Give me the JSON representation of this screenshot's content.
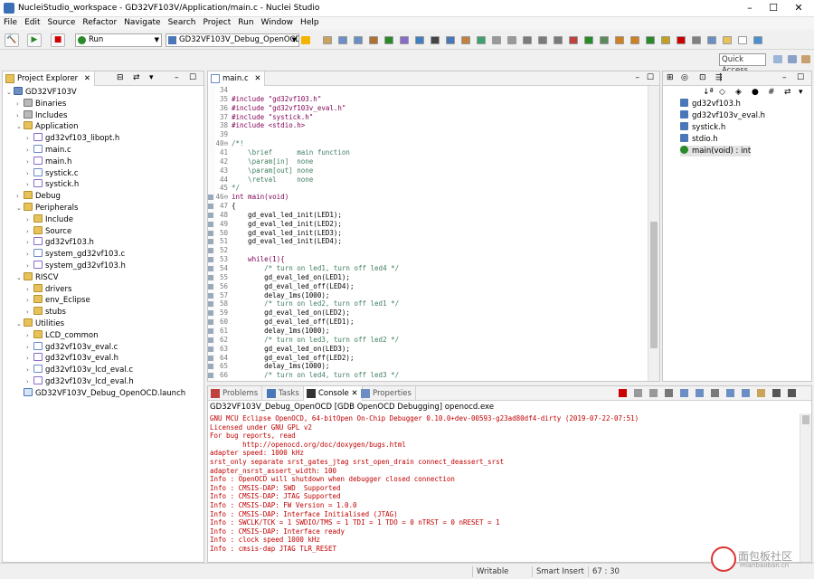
{
  "window": {
    "title": "NucleiStudio_workspace - GD32VF103V/Application/main.c - Nuclei Studio"
  },
  "menu": [
    "File",
    "Edit",
    "Source",
    "Refactor",
    "Navigate",
    "Search",
    "Project",
    "Run",
    "Window",
    "Help"
  ],
  "toolbar": {
    "run_mode": "Run",
    "launch_config": "GD32VF103V_Debug_OpenOCD",
    "quick_access": "Quick Access"
  },
  "project_explorer": {
    "tab_label": "Project Explorer",
    "items": [
      {
        "label": "GD32VF103V",
        "depth": 0,
        "type": "proj",
        "open": true
      },
      {
        "label": "Binaries",
        "depth": 1,
        "type": "bin",
        "open": false
      },
      {
        "label": "Includes",
        "depth": 1,
        "type": "bin",
        "open": false
      },
      {
        "label": "Application",
        "depth": 1,
        "type": "folder",
        "open": true
      },
      {
        "label": "gd32vf103_libopt.h",
        "depth": 2,
        "type": "hfile",
        "open": false
      },
      {
        "label": "main.c",
        "depth": 2,
        "type": "cfile",
        "open": false
      },
      {
        "label": "main.h",
        "depth": 2,
        "type": "hfile",
        "open": false
      },
      {
        "label": "systick.c",
        "depth": 2,
        "type": "cfile",
        "open": false
      },
      {
        "label": "systick.h",
        "depth": 2,
        "type": "hfile",
        "open": false
      },
      {
        "label": "Debug",
        "depth": 1,
        "type": "folder",
        "open": false
      },
      {
        "label": "Peripherals",
        "depth": 1,
        "type": "folder",
        "open": true
      },
      {
        "label": "Include",
        "depth": 2,
        "type": "folder",
        "open": false
      },
      {
        "label": "Source",
        "depth": 2,
        "type": "folder",
        "open": false
      },
      {
        "label": "gd32vf103.h",
        "depth": 2,
        "type": "hfile",
        "open": false
      },
      {
        "label": "system_gd32vf103.c",
        "depth": 2,
        "type": "cfile",
        "open": false
      },
      {
        "label": "system_gd32vf103.h",
        "depth": 2,
        "type": "hfile",
        "open": false
      },
      {
        "label": "RISCV",
        "depth": 1,
        "type": "folder",
        "open": true
      },
      {
        "label": "drivers",
        "depth": 2,
        "type": "folder",
        "open": false
      },
      {
        "label": "env_Eclipse",
        "depth": 2,
        "type": "folder",
        "open": false
      },
      {
        "label": "stubs",
        "depth": 2,
        "type": "folder",
        "open": false
      },
      {
        "label": "Utilities",
        "depth": 1,
        "type": "folder",
        "open": true
      },
      {
        "label": "LCD_common",
        "depth": 2,
        "type": "folder",
        "open": false
      },
      {
        "label": "gd32vf103v_eval.c",
        "depth": 2,
        "type": "cfile",
        "open": false
      },
      {
        "label": "gd32vf103v_eval.h",
        "depth": 2,
        "type": "hfile",
        "open": false
      },
      {
        "label": "gd32vf103v_lcd_eval.c",
        "depth": 2,
        "type": "cfile",
        "open": false
      },
      {
        "label": "gd32vf103v_lcd_eval.h",
        "depth": 2,
        "type": "hfile",
        "open": false
      },
      {
        "label": "GD32VF103V_Debug_OpenOCD.launch",
        "depth": 1,
        "type": "launch",
        "open": false
      }
    ]
  },
  "editor": {
    "tab_label": "main.c",
    "lines": [
      {
        "n": "34",
        "t": ""
      },
      {
        "n": "35",
        "t": "#include \"gd32vf103.h\""
      },
      {
        "n": "36",
        "t": "#include \"gd32vf103v_eval.h\""
      },
      {
        "n": "37",
        "t": "#include \"systick.h\""
      },
      {
        "n": "38",
        "t": "#include <stdio.h>"
      },
      {
        "n": "39",
        "t": ""
      },
      {
        "n": "40⊖",
        "t": "/*!"
      },
      {
        "n": "41",
        "t": "    \\brief      main function"
      },
      {
        "n": "42",
        "t": "    \\param[in]  none"
      },
      {
        "n": "43",
        "t": "    \\param[out] none"
      },
      {
        "n": "44",
        "t": "    \\retval     none"
      },
      {
        "n": "45",
        "t": "*/"
      },
      {
        "n": "46⊖",
        "t": "int main(void)"
      },
      {
        "n": "47",
        "t": "{"
      },
      {
        "n": "48",
        "t": "    gd_eval_led_init(LED1);"
      },
      {
        "n": "49",
        "t": "    gd_eval_led_init(LED2);"
      },
      {
        "n": "50",
        "t": "    gd_eval_led_init(LED3);"
      },
      {
        "n": "51",
        "t": "    gd_eval_led_init(LED4);"
      },
      {
        "n": "52",
        "t": ""
      },
      {
        "n": "53",
        "t": "    while(1){"
      },
      {
        "n": "54",
        "t": "        /* turn on led1, turn off led4 */"
      },
      {
        "n": "55",
        "t": "        gd_eval_led_on(LED1);"
      },
      {
        "n": "56",
        "t": "        gd_eval_led_off(LED4);"
      },
      {
        "n": "57",
        "t": "        delay_1ms(1000);"
      },
      {
        "n": "58",
        "t": "        /* turn on led2, turn off led1 */"
      },
      {
        "n": "59",
        "t": "        gd_eval_led_on(LED2);"
      },
      {
        "n": "60",
        "t": "        gd_eval_led_off(LED1);"
      },
      {
        "n": "61",
        "t": "        delay_1ms(1000);"
      },
      {
        "n": "62",
        "t": "        /* turn on led3, turn off led2 */"
      },
      {
        "n": "63",
        "t": "        gd_eval_led_on(LED3);"
      },
      {
        "n": "64",
        "t": "        gd_eval_led_off(LED2);"
      },
      {
        "n": "65",
        "t": "        delay_1ms(1000);"
      },
      {
        "n": "66",
        "t": "        /* turn on led4, turn off led3 */"
      }
    ]
  },
  "outline": {
    "items": [
      {
        "label": "gd32vf103.h",
        "type": "hfile"
      },
      {
        "label": "gd32vf103v_eval.h",
        "type": "hfile"
      },
      {
        "label": "systick.h",
        "type": "hfile"
      },
      {
        "label": "stdio.h",
        "type": "hfile"
      },
      {
        "label": "main(void) : int",
        "type": "fn"
      }
    ]
  },
  "bottom_panel": {
    "tabs": [
      "Problems",
      "Tasks",
      "Console",
      "Properties"
    ],
    "active_tab": "Console",
    "console_title": "GD32VF103V_Debug_OpenOCD [GDB OpenOCD Debugging] openocd.exe",
    "lines": [
      "GNU MCU Eclipse OpenOCD, 64-bitOpen On-Chip Debugger 0.10.0+dev-00593-g23ad80df4-dirty (2019-07-22-07:51)",
      "Licensed under GNU GPL v2",
      "For bug reports, read",
      "        http://openocd.org/doc/doxygen/bugs.html",
      "adapter speed: 1000 kHz",
      "srst_only separate srst_gates_jtag srst_open_drain connect_deassert_srst",
      "adapter_nsrst_assert_width: 100",
      "Info : OpenOCD will shutdown when debugger closed connection",
      "Info : CMSIS-DAP: SWD  Supported",
      "Info : CMSIS-DAP: JTAG Supported",
      "Info : CMSIS-DAP: FW Version = 1.0.0",
      "Info : CMSIS-DAP: Interface Initialised (JTAG)",
      "Info : SWCLK/TCK = 1 SWDIO/TMS = 1 TDI = 1 TDO = 0 nTRST = 0 nRESET = 1",
      "Info : CMSIS-DAP: Interface ready",
      "Info : clock speed 1000 kHz",
      "Info : cmsis-dap JTAG TLR_RESET"
    ]
  },
  "status": {
    "writable": "Writable",
    "insert_mode": "Smart Insert",
    "position": "67 : 30"
  },
  "watermark": {
    "text": "面包板社区",
    "sub": "mianbaoban.cn"
  },
  "colors": {
    "console_error": "#c00000",
    "comment": "#3f7f5f",
    "keyword": "#7f0055"
  }
}
